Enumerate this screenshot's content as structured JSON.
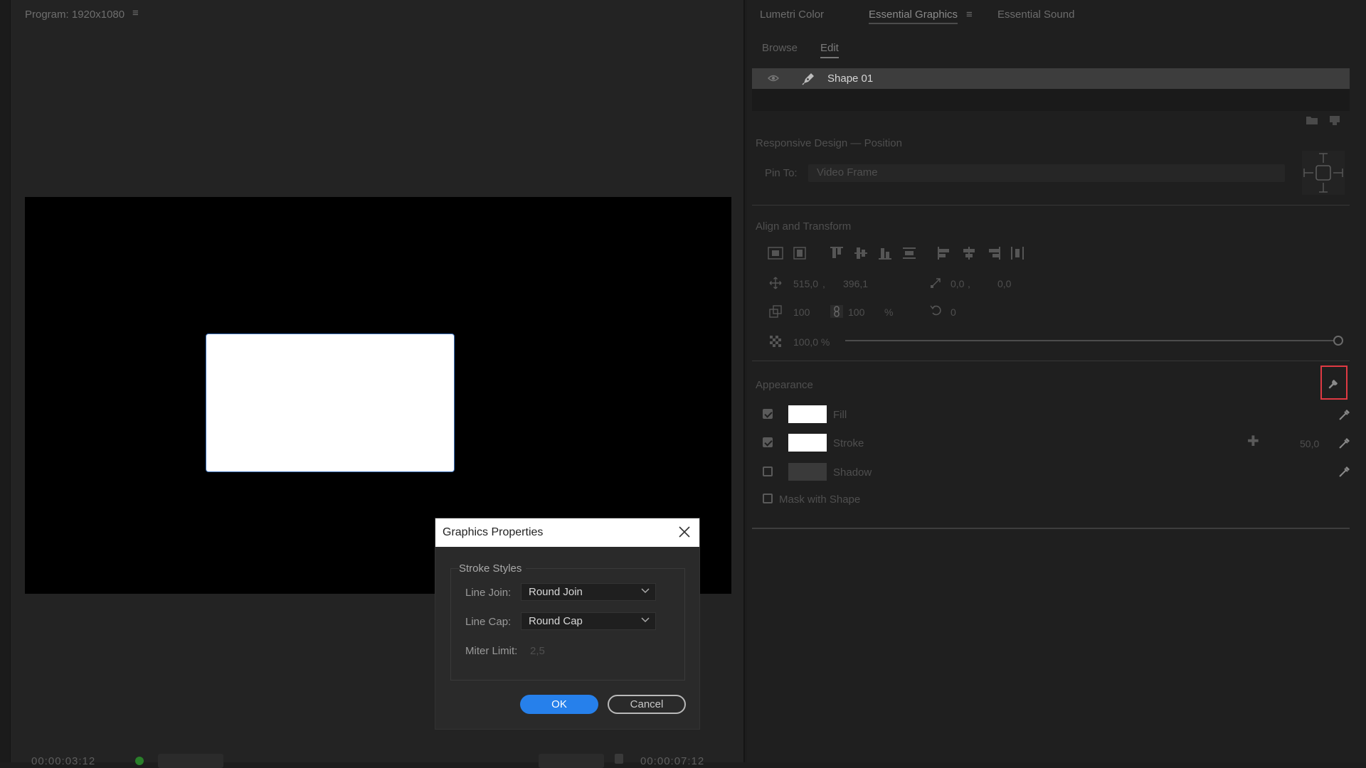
{
  "program": {
    "title": "Program: 1920x1080",
    "menu_glyph": "≡",
    "timecode_left": "00:00:03:12",
    "timecode_right": "00:00:07:12"
  },
  "panel": {
    "tabs": [
      "Lumetri Color",
      "Essential Graphics",
      "Essential Sound"
    ],
    "active_tab": "Essential Graphics",
    "menu_glyph": "≡",
    "subtabs": [
      "Browse",
      "Edit"
    ],
    "active_subtab": "Edit",
    "layer": {
      "name": "Shape 01"
    },
    "responsive": {
      "title": "Responsive Design — Position",
      "pin_label": "Pin To:",
      "pin_value": "Video Frame"
    },
    "align": {
      "title": "Align and Transform",
      "position_x": "515,0",
      "position_y": "396,1",
      "anchor_x": "0,0",
      "anchor_y": "0,0",
      "scale_w": "100",
      "scale_h": "100",
      "scale_unit": "%",
      "rotation": "0",
      "opacity": "100,0 %",
      "comma": ","
    },
    "appearance": {
      "title": "Appearance",
      "fill_label": "Fill",
      "fill_checked": true,
      "stroke_label": "Stroke",
      "stroke_checked": true,
      "stroke_width": "50,0",
      "shadow_label": "Shadow",
      "shadow_checked": false,
      "mask_label": "Mask with Shape",
      "mask_checked": false,
      "highlight_color": "#e03a43"
    }
  },
  "dialog": {
    "title": "Graphics Properties",
    "group": "Stroke Styles",
    "line_join_label": "Line Join:",
    "line_join_value": "Round Join",
    "line_cap_label": "Line Cap:",
    "line_cap_value": "Round Cap",
    "miter_label": "Miter Limit:",
    "miter_value": "2,5",
    "ok_label": "OK",
    "cancel_label": "Cancel",
    "accent": "#2680eb"
  }
}
